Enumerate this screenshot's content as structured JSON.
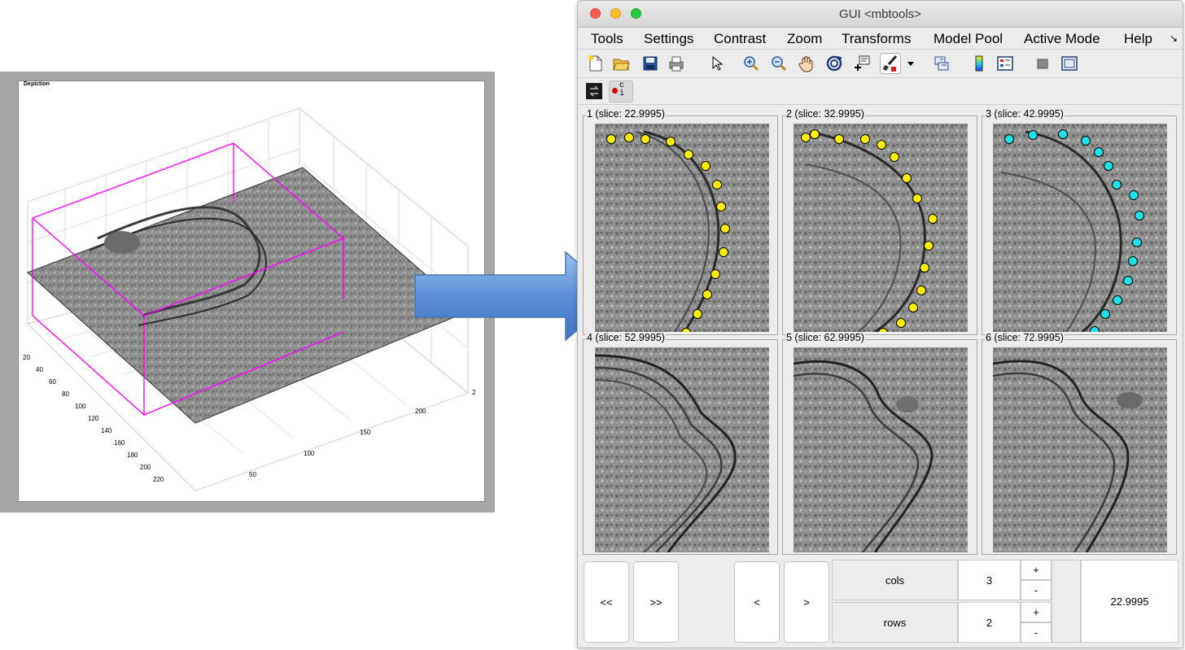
{
  "depiction": {
    "panel_title": "Depiction",
    "y_ticks": [
      "20",
      "40",
      "60",
      "80",
      "100",
      "120",
      "140",
      "160",
      "180",
      "200",
      "220"
    ],
    "x_ticks": [
      "50",
      "100",
      "150",
      "200"
    ],
    "corner_tick": "2",
    "box_color": "#ff00ff"
  },
  "window": {
    "title": "GUI <mbtools>"
  },
  "menu": {
    "items": [
      "Tools",
      "Settings",
      "Contrast",
      "Zoom",
      "Transforms",
      "Model Pool",
      "Active Mode",
      "Help"
    ],
    "corner_icon": "↘"
  },
  "toolbar": {
    "icons": [
      "new-file-icon",
      "open-folder-icon",
      "save-icon",
      "print-icon",
      "pointer-icon",
      "zoom-in-icon",
      "zoom-out-icon",
      "pan-hand-icon",
      "rotate-3d-icon",
      "data-cursor-icon",
      "brush-icon",
      "dropdown-arrow-icon",
      "link-plot-icon",
      "colorbar-icon",
      "legend-icon",
      "hide-tool-icon",
      "show-tool-icon"
    ],
    "second_row": [
      "switch-tool-icon",
      "tool-ci-icon"
    ],
    "ci_glyph": "c\ni"
  },
  "tiles": [
    {
      "label": "1 (slice: 22.9995)",
      "marker_color": "#ffee00"
    },
    {
      "label": "2 (slice: 32.9995)",
      "marker_color": "#ffee00"
    },
    {
      "label": "3 (slice: 42.9995)",
      "marker_color": "#1fe0e6"
    },
    {
      "label": "4 (slice: 52.9995)"
    },
    {
      "label": "5 (slice: 62.9995)"
    },
    {
      "label": "6 (slice: 72.9995)"
    }
  ],
  "controls": {
    "first": "<<",
    "last": ">>",
    "prev": "<",
    "next": ">",
    "cols_label": "cols",
    "cols_value": "3",
    "rows_label": "rows",
    "rows_value": "2",
    "plus": "+",
    "minus": "-",
    "slice_value": "22.9995"
  }
}
